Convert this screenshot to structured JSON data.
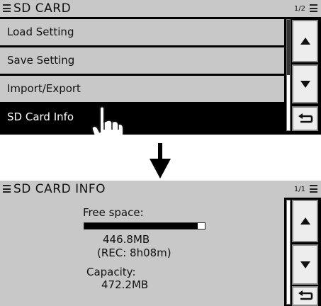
{
  "screen1": {
    "title": "SD CARD",
    "page": "1/2",
    "items": [
      {
        "label": "Load Setting"
      },
      {
        "label": "Save Setting"
      },
      {
        "label": "Import/Export"
      },
      {
        "label": "SD Card Info"
      }
    ],
    "selected": "SD Card Info"
  },
  "screen2": {
    "title": "SD CARD INFO",
    "page": "1/1",
    "free_space_label": "Free space:",
    "free_space_used_fraction": 0.94,
    "free_space_value": "446.8MB",
    "rec_time": "(REC: 8h08m)",
    "capacity_label": "Capacity:",
    "capacity_value": "472.2MB"
  },
  "colors": {
    "list_bg": "#c8c8c8",
    "selected_bg": "#000000",
    "screen_bg": "#000000"
  },
  "icons": [
    "menu-icon",
    "up-arrow-icon",
    "down-arrow-icon",
    "back-icon",
    "down-arrow-indicator-icon",
    "pointing-hand-icon"
  ]
}
